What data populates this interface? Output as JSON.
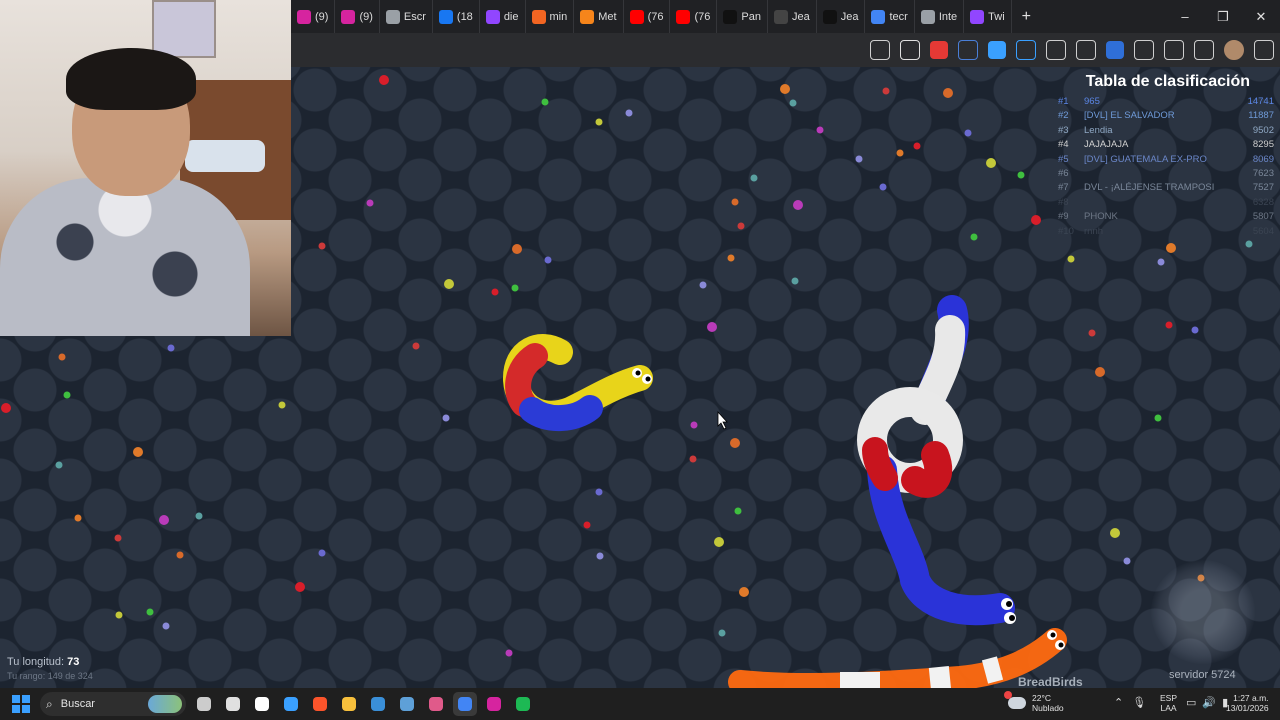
{
  "browser": {
    "tabs": [
      {
        "label": "(9)",
        "icon": "instagram-icon",
        "color": "#d6249f"
      },
      {
        "label": "(9)",
        "icon": "instagram-icon",
        "color": "#d6249f"
      },
      {
        "label": "Escr",
        "icon": "font-a-icon",
        "color": "#9aa0a6"
      },
      {
        "label": "(18",
        "icon": "facebook-icon",
        "color": "#1877f2"
      },
      {
        "label": "die",
        "icon": "twitch-icon",
        "color": "#9146ff"
      },
      {
        "label": "min",
        "icon": "rss-icon",
        "color": "#f26522"
      },
      {
        "label": "Met",
        "icon": "metamask-icon",
        "color": "#f6851b"
      },
      {
        "label": "(76",
        "icon": "youtube-icon",
        "color": "#ff0000"
      },
      {
        "label": "(76",
        "icon": "youtube-icon",
        "color": "#ff0000"
      },
      {
        "label": "Pan",
        "icon": "tiktok-icon",
        "color": "#111111"
      },
      {
        "label": "Jea",
        "icon": "threads-icon",
        "color": "#444444"
      },
      {
        "label": "Jea",
        "icon": "tiktok-icon",
        "color": "#111111"
      },
      {
        "label": "tecr",
        "icon": "google-icon",
        "color": "#4285f4"
      },
      {
        "label": "Inte",
        "icon": "globe-icon",
        "color": "#9aa0a6"
      },
      {
        "label": "Twi",
        "icon": "twitch-icon",
        "color": "#9146ff"
      }
    ],
    "new_tab": "+",
    "window_controls": [
      "–",
      "❐",
      "✕"
    ],
    "extensions": [
      "translate-icon",
      "star-icon",
      "abp-icon",
      "wave-icon",
      "s-icon",
      "puzzle-blue-icon",
      "shield-icon",
      "note-icon",
      "t-icon",
      "pen-icon",
      "lab-icon",
      "puzzle-icon",
      "avatar-icon",
      "menu-icon"
    ]
  },
  "leaderboard": {
    "title": "Tabla de clasificación",
    "rows": [
      {
        "rank": "#1",
        "name": "965",
        "score": "14741"
      },
      {
        "rank": "#2",
        "name": "[DVL] EL SALVADOR",
        "score": "11887"
      },
      {
        "rank": "#3",
        "name": "Lendia",
        "score": "9502"
      },
      {
        "rank": "#4",
        "name": "JAJAJAJA",
        "score": "8295"
      },
      {
        "rank": "#5",
        "name": "[DVL] GUATEMALA EX-PRO",
        "score": "8069"
      },
      {
        "rank": "#6",
        "name": "",
        "score": "7623"
      },
      {
        "rank": "#7",
        "name": "DVL - ¡ALÉJENSE TRAMPOSI",
        "score": "7527"
      },
      {
        "rank": "#8",
        "name": "",
        "score": "6328"
      },
      {
        "rank": "#9",
        "name": "PHONK",
        "score": "5807"
      },
      {
        "rank": "#10",
        "name": "rnnh",
        "score": "5604"
      }
    ],
    "row_colors": [
      "#5b86e5",
      "#6f9ad8",
      "#8fa8c4",
      "#cfcfcf",
      "#6a86c8",
      "#7a8799",
      "#7a8799",
      "#3b4452",
      "#6d7786",
      "#3b4452"
    ]
  },
  "hud": {
    "length_label": "Tu longitud:",
    "length_value": "73",
    "rank_text": "Tu rango: 149 de 324",
    "server": "servidor 5724",
    "brand": "BreadBirds"
  },
  "taskbar": {
    "search_label": "Buscar",
    "weather_temp": "22°C",
    "weather_desc": "Nublado",
    "lang_1": "ESP",
    "lang_2": "LAA",
    "time": "1:27 a.m.",
    "date": "13/01/2026",
    "apps": [
      {
        "icon": "task-view-icon",
        "color": "#cccccc"
      },
      {
        "icon": "chrome-icon",
        "color": "#e0e0e0"
      },
      {
        "icon": "capcut-icon",
        "color": "#ffffff"
      },
      {
        "icon": "store-icon",
        "color": "#3aa0ff"
      },
      {
        "icon": "brave-icon",
        "color": "#fb542b"
      },
      {
        "icon": "folder-icon",
        "color": "#f8c03c"
      },
      {
        "icon": "photos-icon",
        "color": "#3a8fd8"
      },
      {
        "icon": "calculator-icon",
        "color": "#5ea0d8"
      },
      {
        "icon": "snip-icon",
        "color": "#e05a8a"
      },
      {
        "icon": "chrome-icon",
        "color": "#4285f4"
      },
      {
        "icon": "instagram-icon",
        "color": "#d6249f"
      },
      {
        "icon": "spotify-icon",
        "color": "#1db954"
      }
    ]
  }
}
